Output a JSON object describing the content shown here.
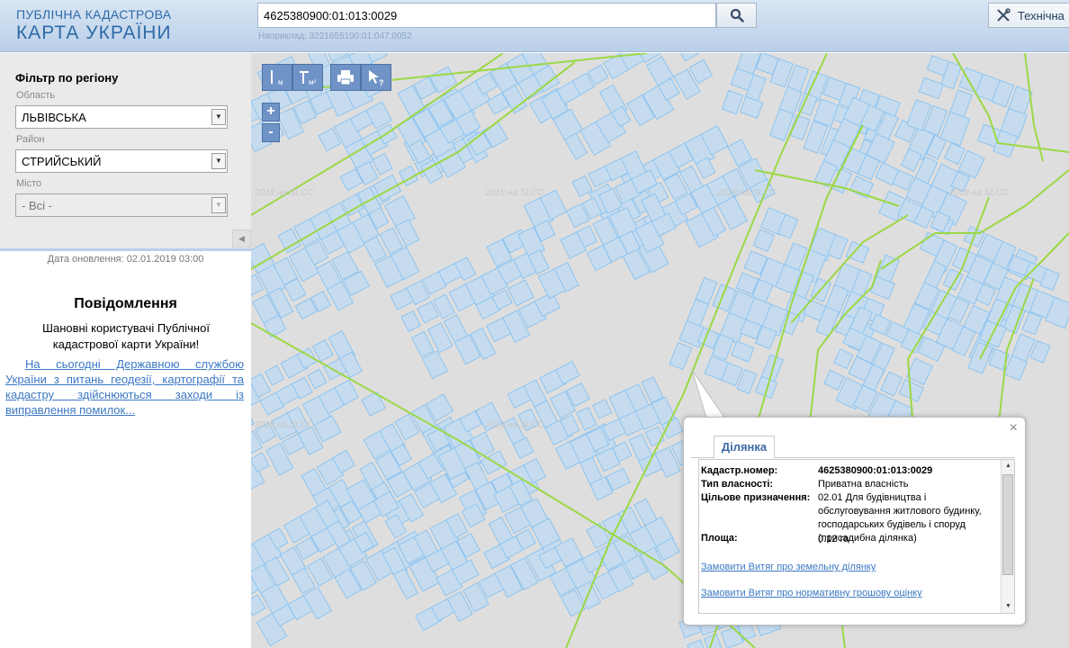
{
  "header": {
    "logo_line1": "ПУБЛІЧНА КАДАСТРОВА",
    "logo_line2": "КАРТА УКРАЇНИ",
    "search_value": "4625380900:01:013:0029",
    "search_example": "Наприклад: 3221655100:01:047:0052",
    "search_icon": "magnifier-icon",
    "tech_label": "Технічна",
    "tech_icon": "tools-icon"
  },
  "filter": {
    "title": "Фільтр по регіону",
    "oblast_label": "Область",
    "oblast_value": "ЛЬВІВСЬКА",
    "rayon_label": "Район",
    "rayon_value": "СТРИЙСЬКИЙ",
    "misto_label": "Місто",
    "misto_value": "- Всі -",
    "collapse_symbol": "◀"
  },
  "update_date": "Дата оновлення: 02.01.2019 03:00",
  "notice": {
    "title": "Повідомлення",
    "text": "Шановні користувачі Публічної кадастрової карти України!",
    "link": "На сьогодні Державною службою України з питань геодезії, картографії та кадастру здійснюються заходи із виправлення помилок..."
  },
  "map": {
    "watermark": "2018.на.SLCC",
    "zoom_in": "+",
    "zoom_out": "-",
    "tools": [
      {
        "icon": "measure-distance-icon",
        "sub": "м"
      },
      {
        "icon": "measure-area-icon",
        "sub": "м²"
      },
      {
        "icon": "print-icon",
        "sub": ""
      },
      {
        "icon": "identify-help-icon",
        "sub": ""
      }
    ],
    "colors": {
      "parcel_fill": "#c6dcee",
      "parcel_stroke": "#8ec4f0",
      "boundary": "#9bd845",
      "background": "#dedede"
    }
  },
  "popup": {
    "tab": "Ділянка",
    "close": "×",
    "cadastral_label": "Кадастр.номер:",
    "cadastral_value": "4625380900:01:013:0029",
    "ownership_label": "Тип власності:",
    "ownership_value": "Приватна власність",
    "purpose_label": "Цільове призначення:",
    "purpose_value": "02.01 Для будівництва і обслуговування житлового будинку, господарських будівель і споруд (присадибна ділянка)",
    "area_label": "Площа:",
    "area_value": "0.12 га",
    "link1": "Замовити Витяг про земельну ділянку",
    "link2": "Замовити Витяг про нормативну грошову оцінку"
  }
}
